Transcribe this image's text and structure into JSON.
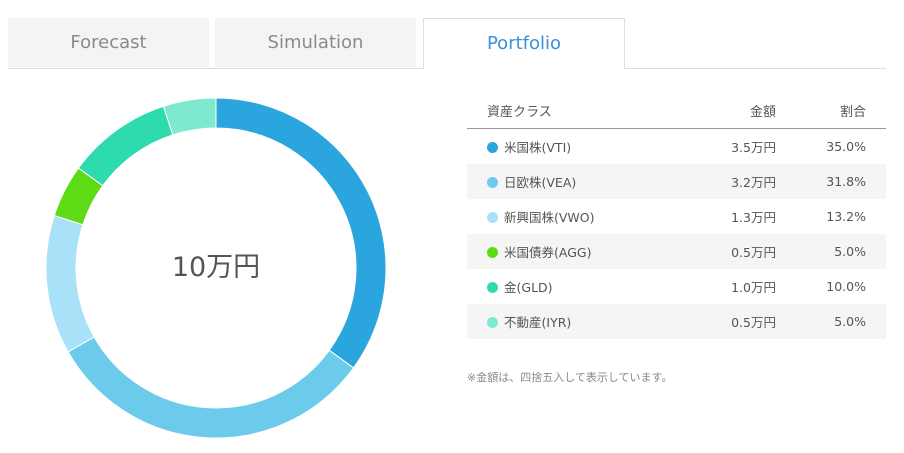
{
  "tabs": [
    {
      "label": "Forecast",
      "active": false
    },
    {
      "label": "Simulation",
      "active": false
    },
    {
      "label": "Portfolio",
      "active": true
    }
  ],
  "chart_data": {
    "type": "pie",
    "center_label": "10万円",
    "categories": [
      "米国株(VTI)",
      "日欧株(VEA)",
      "新興国株(VWO)",
      "米国債券(AGG)",
      "金(GLD)",
      "不動産(IYR)"
    ],
    "values": [
      35.0,
      31.8,
      13.2,
      5.0,
      10.0,
      5.0
    ],
    "colors": [
      "#2aa5dd",
      "#6ccbeb",
      "#a8e1f8",
      "#5ddb14",
      "#2edbaf",
      "#7fe9cf"
    ]
  },
  "table": {
    "headers": {
      "asset": "資産クラス",
      "amount": "金額",
      "ratio": "割合"
    },
    "rows": [
      {
        "name": "米国株(VTI)",
        "amount": "3.5万円",
        "ratio": "35.0%",
        "color": "#2aa5dd"
      },
      {
        "name": "日欧株(VEA)",
        "amount": "3.2万円",
        "ratio": "31.8%",
        "color": "#6ccbeb"
      },
      {
        "name": "新興国株(VWO)",
        "amount": "1.3万円",
        "ratio": "13.2%",
        "color": "#a8e1f8"
      },
      {
        "name": "米国債券(AGG)",
        "amount": "0.5万円",
        "ratio": "5.0%",
        "color": "#5ddb14"
      },
      {
        "name": "金(GLD)",
        "amount": "1.0万円",
        "ratio": "10.0%",
        "color": "#2edbaf"
      },
      {
        "name": "不動産(IYR)",
        "amount": "0.5万円",
        "ratio": "5.0%",
        "color": "#7fe9cf"
      }
    ]
  },
  "note": "※金額は、四捨五入して表示しています。"
}
